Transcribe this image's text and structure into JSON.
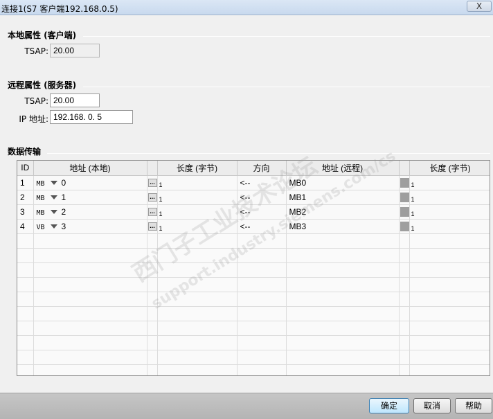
{
  "window": {
    "title": "连接1(S7 客户端192.168.0.5)"
  },
  "local": {
    "section_title": "本地属性 (客户端)",
    "tsap_label": "TSAP:",
    "tsap_value": "20.00"
  },
  "remote": {
    "section_title": "远程属性 (服务器)",
    "tsap_label": "TSAP:",
    "tsap_value": "20.00",
    "ip_label": "IP 地址:",
    "ip_value": "192.168.  0.  5"
  },
  "transfer": {
    "section_title": "数据传输",
    "headers": [
      "ID",
      "地址 (本地)",
      "",
      "长度 (字节)",
      "方向",
      "地址 (远程)",
      "",
      "长度 (字节)"
    ],
    "rows": [
      {
        "id": "1",
        "area": "MB",
        "addr": "0",
        "local_len": "1",
        "direction": "<--",
        "remote": "MB0",
        "remote_len": "1"
      },
      {
        "id": "2",
        "area": "MB",
        "addr": "1",
        "local_len": "1",
        "direction": "<--",
        "remote": "MB1",
        "remote_len": "1"
      },
      {
        "id": "3",
        "area": "MB",
        "addr": "2",
        "local_len": "1",
        "direction": "<--",
        "remote": "MB2",
        "remote_len": "1"
      },
      {
        "id": "4",
        "area": "VB",
        "addr": "3",
        "local_len": "1",
        "direction": "<--",
        "remote": "MB3",
        "remote_len": "1"
      }
    ],
    "browse_button": "..."
  },
  "buttons": {
    "ok": "确定",
    "cancel": "取消",
    "help": "帮助"
  },
  "close_button": "X",
  "watermark": {
    "cn": "西门子工业技术论坛",
    "url": "support.industry.siemens.com/cs"
  }
}
